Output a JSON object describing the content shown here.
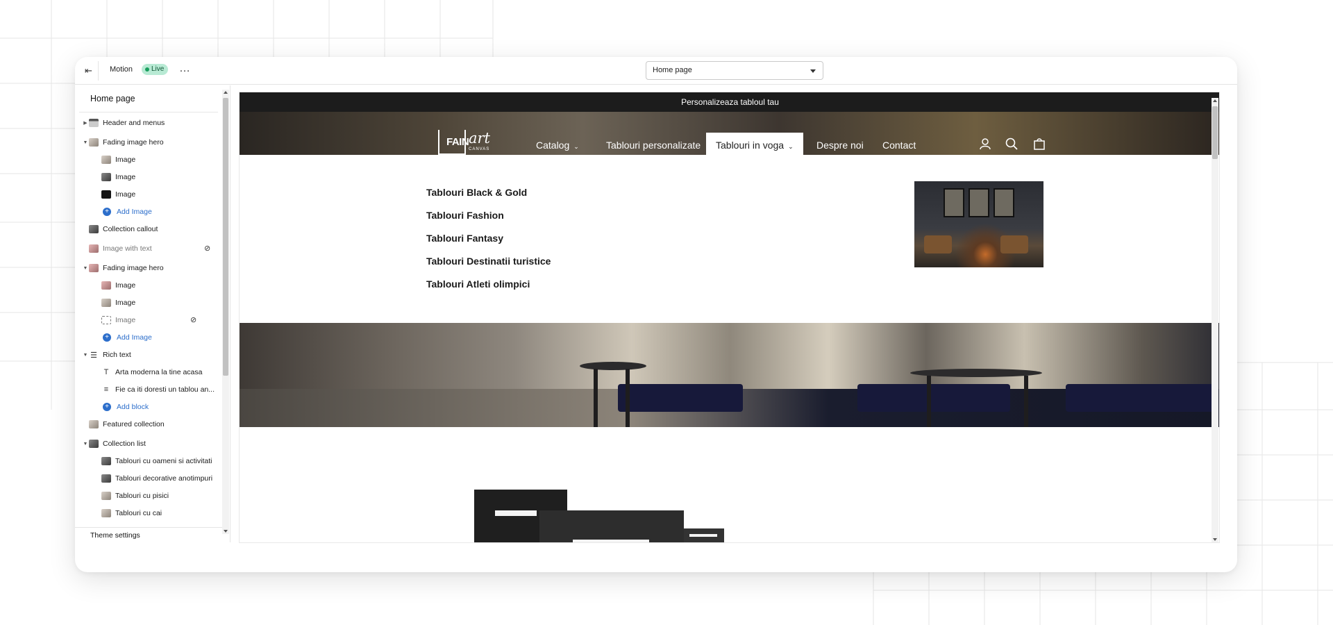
{
  "topbar": {
    "theme_name": "Motion",
    "status_badge": "Live",
    "more_icon": "…",
    "page_selector_value": "Home page"
  },
  "sidebar": {
    "title": "Home page",
    "items": [
      {
        "label": "Header and menus",
        "icon": "header-icon"
      },
      {
        "label": "Fading image hero",
        "icon": "image-icon"
      },
      {
        "label": "Image",
        "icon": "image-icon"
      },
      {
        "label": "Image",
        "icon": "image-icon"
      },
      {
        "label": "Image",
        "icon": "image-icon"
      },
      {
        "label": "Add Image",
        "icon": "plus-icon"
      },
      {
        "label": "Collection callout",
        "icon": "image-icon"
      },
      {
        "label": "Image with text",
        "icon": "image-icon",
        "hidden": true
      },
      {
        "label": "Fading image hero",
        "icon": "image-icon"
      },
      {
        "label": "Image",
        "icon": "image-icon"
      },
      {
        "label": "Image",
        "icon": "image-icon"
      },
      {
        "label": "Image",
        "icon": "image-placeholder-icon",
        "hidden": true
      },
      {
        "label": "Add Image",
        "icon": "plus-icon"
      },
      {
        "label": "Rich text",
        "icon": "text-block-icon"
      },
      {
        "label": "Arta moderna la tine acasa",
        "icon": "heading-icon"
      },
      {
        "label": "Fie ca iti doresti un tablou an...",
        "icon": "paragraph-icon"
      },
      {
        "label": "Add block",
        "icon": "plus-icon"
      },
      {
        "label": "Featured collection",
        "icon": "image-icon"
      },
      {
        "label": "Collection list",
        "icon": "image-icon"
      },
      {
        "label": "Tablouri cu oameni si activitati",
        "icon": "image-icon"
      },
      {
        "label": "Tablouri decorative anotimpuri",
        "icon": "image-icon"
      },
      {
        "label": "Tablouri cu pisici",
        "icon": "image-icon"
      },
      {
        "label": "Tablouri cu cai",
        "icon": "image-icon"
      }
    ],
    "theme_settings": "Theme settings"
  },
  "preview": {
    "announcement": "Personalizeaza tabloul tau",
    "logo": {
      "main": "FAIN",
      "script": "art",
      "sub": "CANVAS"
    },
    "nav": [
      {
        "label": "Catalog",
        "has_dropdown": true
      },
      {
        "label": "Tablouri personalizate",
        "has_dropdown": false
      },
      {
        "label": "Tablouri in vogа",
        "has_dropdown": true,
        "active": true
      },
      {
        "label": "Despre noi",
        "has_dropdown": false
      },
      {
        "label": "Contact",
        "has_dropdown": false
      }
    ],
    "dropdown_links": [
      "Tablouri Black & Gold",
      "Tablouri Fashion",
      "Tablouri Fantasy",
      "Tablouri Destinatii turistice",
      "Tablouri Atleti olimpici"
    ],
    "header_icons": [
      "account-icon",
      "search-icon",
      "cart-icon"
    ]
  }
}
